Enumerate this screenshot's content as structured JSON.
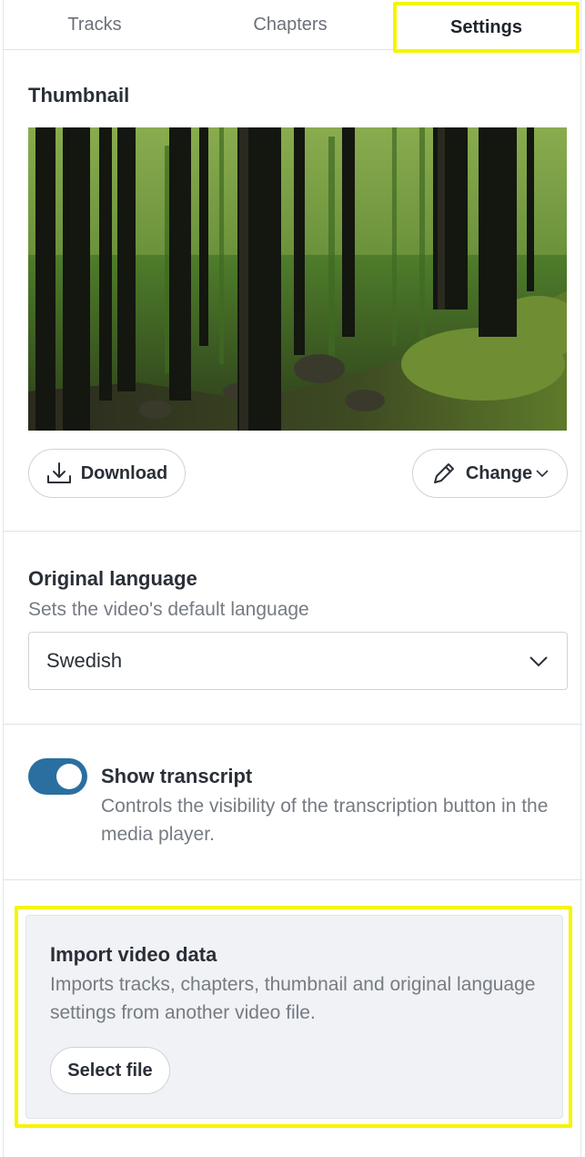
{
  "tabs": [
    {
      "label": "Tracks"
    },
    {
      "label": "Chapters"
    },
    {
      "label": "Settings"
    }
  ],
  "active_tab": "Settings",
  "thumbnail": {
    "title": "Thumbnail",
    "download_label": "Download",
    "change_label": "Change"
  },
  "language": {
    "title": "Original language",
    "description": "Sets the video's default language",
    "selected": "Swedish"
  },
  "transcript": {
    "title": "Show transcript",
    "description": "Controls the visibility of the transcription button in the media player.",
    "enabled": true
  },
  "import": {
    "title": "Import video data",
    "description": "Imports tracks, chapters, thumbnail and original language settings from another video file.",
    "button_label": "Select file"
  },
  "colors": {
    "accent": "#2a6fa0",
    "highlight": "#f5f500",
    "import_bg": "#f0f2f5"
  },
  "icons": {
    "download": "download-icon",
    "change": "pencil-icon",
    "change_menu": "chevron-down-icon",
    "select": "chevron-down-icon"
  }
}
